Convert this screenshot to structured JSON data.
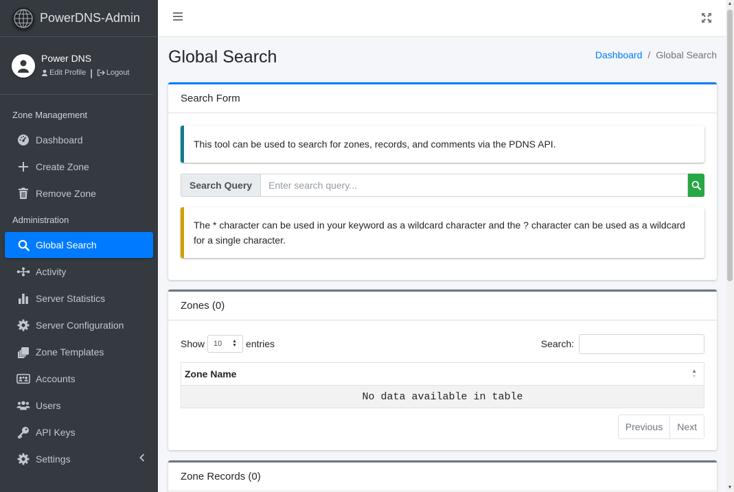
{
  "app": {
    "title": "PowerDNS-Admin"
  },
  "user": {
    "name": "Power DNS",
    "edit_profile": "Edit Profile",
    "logout": "Logout"
  },
  "sidebar": {
    "headers": [
      "Zone Management",
      "Administration"
    ],
    "items": [
      {
        "label": "Dashboard",
        "icon": "dashboard-icon"
      },
      {
        "label": "Create Zone",
        "icon": "plus-icon"
      },
      {
        "label": "Remove Zone",
        "icon": "trash-icon"
      },
      {
        "label": "Global Search",
        "icon": "search-icon",
        "active": true
      },
      {
        "label": "Activity",
        "icon": "activity-icon"
      },
      {
        "label": "Server Statistics",
        "icon": "bar-chart-icon"
      },
      {
        "label": "Server Configuration",
        "icon": "gear-icon"
      },
      {
        "label": "Zone Templates",
        "icon": "clone-icon"
      },
      {
        "label": "Accounts",
        "icon": "accounts-icon"
      },
      {
        "label": "Users",
        "icon": "users-icon"
      },
      {
        "label": "API Keys",
        "icon": "key-icon"
      },
      {
        "label": "Settings",
        "icon": "gear-icon"
      }
    ]
  },
  "page": {
    "title": "Global Search",
    "breadcrumb": [
      "Dashboard",
      "/",
      "Global Search"
    ]
  },
  "search_form": {
    "header": "Search Form",
    "info": "This tool can be used to search for zones, records, and comments via the PDNS API.",
    "query_label": "Search Query",
    "query_placeholder": "Enter search query...",
    "query_value": "",
    "hint": "The * character can be used in your keyword as a wildcard character and the ? character can be used as a wildcard for a single character."
  },
  "zones": {
    "header": "Zones (0)",
    "show": "Show",
    "entries_value": "10",
    "entries": "entries",
    "search_label": "Search:",
    "column": "Zone Name",
    "empty": "No data available in table",
    "previous": "Previous",
    "next": "Next"
  },
  "zone_records": {
    "header": "Zone Records (0)"
  },
  "colors": {
    "sidebar": "#343a40",
    "active": "#007bff",
    "success": "#28a745",
    "info": "#117a8b",
    "warning": "#d39e00"
  }
}
